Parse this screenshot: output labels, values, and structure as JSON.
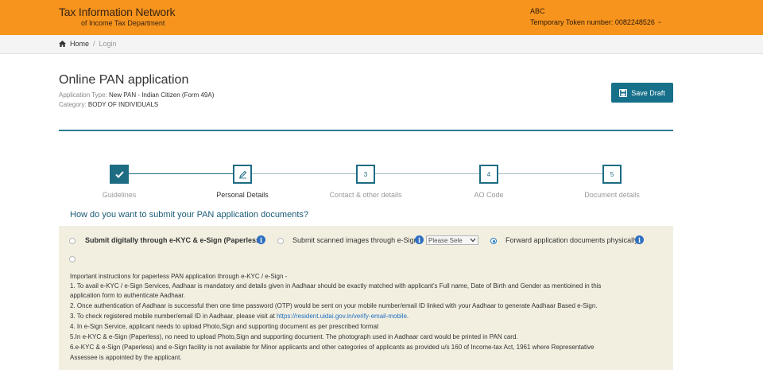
{
  "header": {
    "brand_title": "Tax Information Network",
    "brand_subtitle": "of Income Tax Department",
    "user_name": "ABC",
    "token_label": "Temporary Token number: 0082248526",
    "background_color": "#f7941d"
  },
  "breadcrumb": {
    "home_icon": "home-icon",
    "home": "Home",
    "separator": "/",
    "current": "Login"
  },
  "page": {
    "title": "Online PAN application",
    "application_type_label": "Application Type:",
    "application_type_value": "New PAN - Indian Citizen (Form 49A)",
    "category_label": "Category:",
    "category_value": "BODY OF INDIVIDUALS"
  },
  "toolbar": {
    "save_draft_label": "Save Draft",
    "save_icon": "floppy-disk-icon",
    "accent_color": "#17708a"
  },
  "steps": [
    {
      "number": "",
      "label": "Guidelines",
      "state": "completed",
      "icon": "check-icon"
    },
    {
      "number": "",
      "label": "Personal Details",
      "state": "current",
      "icon": "pencil-icon"
    },
    {
      "number": "3",
      "label": "Contact & other details",
      "state": "pending"
    },
    {
      "number": "4",
      "label": "AO Code",
      "state": "pending"
    },
    {
      "number": "5",
      "label": "Document details",
      "state": "pending"
    }
  ],
  "submission": {
    "question": "How do you want to submit your PAN application documents?",
    "options": [
      {
        "label": "Submit digitally through e-KYC & e-Sign (Paperless)",
        "selected": false
      },
      {
        "label": "Submit scanned images through e-Sign",
        "selected": false
      },
      {
        "label": "Forward application documents physically",
        "selected": true
      }
    ],
    "select_value": "Please Sele",
    "info_icon_text": "i"
  },
  "instructions": {
    "heading": "Important instructions for paperless PAN application through e-KYC / e-Sign -",
    "items": [
      "1. To avail e-KYC / e-Sign Services, Aadhaar is mandatory and details given in Aadhaar should be exactly matched with applicant's Full name, Date of Birth and Gender as mentioined in this",
      "application form to authenticate Aadhaar.",
      "2. Once authentication of Aadhaar is successful then one time password (OTP) would be sent on your mobile number/email ID linked with your Aadhaar to generate Aadhaar Based e-Sign.",
      "3. To check registered mobile number/email ID in Aadhaar, please visit at",
      "4. In e-Sign Service, applicant needs to upload Photo,Sign and supporting document as per prescribed format",
      "5.In e-KYC & e-Sign (Paperless), no need to upload Photo,Sign and supporting document. The photograph used in Aadhaar card would be printed in PAN card.",
      "6.e-KYC & e-Sign (Paperless) and e-Sign facility is not available for Minor applicants and other categories of applicants as provided u/s 160 of Income-tax Act, 1961 where Representative",
      "Assessee is appointed by the applicant."
    ],
    "link": "https://resident.uidai.gov.in/verify-email-mobile",
    "link_suffix": "."
  }
}
